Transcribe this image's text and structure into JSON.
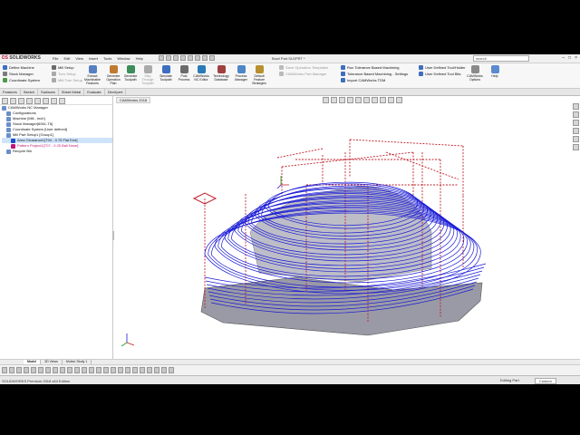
{
  "app": {
    "logo_brand": "DS",
    "logo_name": "SOLIDWORKS",
    "title": "Bowl Part.SLDPRT *",
    "search_placeholder": "search",
    "menu": [
      "File",
      "Edit",
      "View",
      "Insert",
      "Tools",
      "Window",
      "Help"
    ]
  },
  "ribbon": {
    "left": [
      {
        "label": "Define Machine",
        "dim": false,
        "color": "#3a6fc4"
      },
      {
        "label": "Mill Setup",
        "dim": false,
        "color": "#6a6a6a"
      },
      {
        "label": "Stock Manager",
        "dim": false,
        "color": "#7c7c7c"
      },
      {
        "label": "Turn Setup",
        "dim": true,
        "color": "#aaaaaa"
      },
      {
        "label": "Coordinate System",
        "dim": false,
        "color": "#4a9a4a"
      },
      {
        "label": "Mill-Turn Setup",
        "dim": true,
        "color": "#aaaaaa"
      }
    ],
    "big": [
      {
        "label": "Extract Machinable Features",
        "dim": false,
        "color": "#5580c0"
      },
      {
        "label": "Generate Operation Plan",
        "dim": false,
        "color": "#c07a30"
      },
      {
        "label": "Generate Toolpath",
        "dim": false,
        "color": "#3b8e5a"
      },
      {
        "label": "Step Through Toolpath",
        "dim": true,
        "color": "#aaaaaa"
      },
      {
        "label": "Simulate Toolpath",
        "dim": false,
        "color": "#3d6ec0"
      },
      {
        "label": "Post Process",
        "dim": false,
        "color": "#6b6b6b"
      },
      {
        "label": "CAMWorks NC Editor",
        "dim": false,
        "color": "#2a7ab8"
      },
      {
        "label": "Technology Database",
        "dim": false,
        "color": "#a04040"
      },
      {
        "label": "Process Manager",
        "dim": false,
        "color": "#4e86c8"
      },
      {
        "label": "Default Feature Strategies",
        "dim": false,
        "color": "#b89030"
      }
    ],
    "list_mid": [
      {
        "label": "Save Operation Templates",
        "dim": true
      },
      {
        "label": "CAMWorks Part Manager",
        "dim": true
      }
    ],
    "list_right1": [
      {
        "label": "Run Tolerance Based Machining",
        "dim": false
      },
      {
        "label": "Tolerance Based Machining - Settings",
        "dim": false
      },
      {
        "label": "Import CAMWorks TDM",
        "dim": false
      }
    ],
    "list_right2": [
      {
        "label": "User Defined Tool/Holder",
        "dim": false
      },
      {
        "label": "User Defined Tool Bits",
        "dim": false
      }
    ],
    "end_items": [
      {
        "label": "CAMWorks Options"
      },
      {
        "label": "Help"
      }
    ]
  },
  "tabs": [
    "Features",
    "Sketch",
    "Surfaces",
    "Sheet Metal",
    "Evaluate",
    "DimXpert",
    "CAMWorks 2018"
  ],
  "tree": [
    {
      "label": "CAMWorks NC Manager",
      "indent": 0,
      "style": ""
    },
    {
      "label": "Configurations",
      "indent": 1,
      "style": ""
    },
    {
      "label": "Machine [Mill - Inch]",
      "indent": 1,
      "style": ""
    },
    {
      "label": "Stock Manager[6061-T6]",
      "indent": 1,
      "style": ""
    },
    {
      "label": "Coordinate System [User defined]",
      "indent": 1,
      "style": ""
    },
    {
      "label": "Mill Part Setup1 [Group1]",
      "indent": 1,
      "style": ""
    },
    {
      "label": "Area Clearance1[T04 - 0.75 Flat End]",
      "indent": 2,
      "style": "sel"
    },
    {
      "label": "Pattern Project1[T07 - 0.25 Ball Nose]",
      "indent": 2,
      "style": "pink"
    },
    {
      "label": "Recycle Bin",
      "indent": 1,
      "style": ""
    }
  ],
  "viewport_tab": "CAMWorks 2018",
  "bottom_tabs": [
    "Model",
    "3D Views",
    "Motion Study 1"
  ],
  "status": {
    "left": "SOLIDWORKS Premium 2018 x64 Edition",
    "editing": "Editing Part",
    "custom": "Custom"
  },
  "colors": {
    "toolpath": "#1a1ad6",
    "rapid": "#c0202a",
    "part": "#8e8e9a"
  }
}
